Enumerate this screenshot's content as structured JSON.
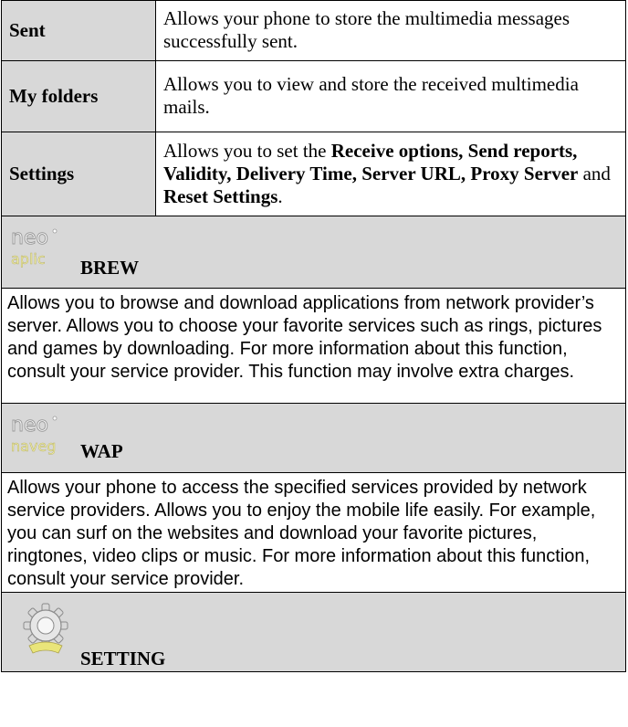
{
  "table": {
    "rows": [
      {
        "label": "Sent",
        "desc": "Allows your phone to store the multimedia messages successfully sent."
      },
      {
        "label": "My folders",
        "desc": "Allows you to view and store the received multimedia mails."
      },
      {
        "label": "Settings",
        "desc_parts": {
          "p1": "Allows you to set the ",
          "b1": "Receive options, Send reports, Validity, Delivery Time, Server URL, Proxy Server",
          "p2": " and ",
          "b2": "Reset Settings",
          "p3": "."
        }
      }
    ]
  },
  "brew": {
    "logo_text_top": "neo",
    "logo_text_bottom": "aplic",
    "title": "BREW",
    "description": "Allows you to browse and download applications from network provider’s server. Allows you to choose your favorite services such as rings, pictures and games by downloading. For more information about this function, consult your service provider. This function may involve extra charges."
  },
  "wap": {
    "logo_text_top": "neo",
    "logo_text_bottom": "naveg",
    "title": "WAP",
    "description": "Allows your phone to access the specified services provided by network service providers. Allows you to enjoy the mobile life easily. For example, you can surf on the websites and download your favorite pictures, ringtones, video clips or music. For more information about this function, consult your service provider."
  },
  "setting": {
    "icon": "gear-icon",
    "title": "SETTING"
  },
  "colors": {
    "header_gray": "#d8d8d8",
    "border": "#000000"
  }
}
